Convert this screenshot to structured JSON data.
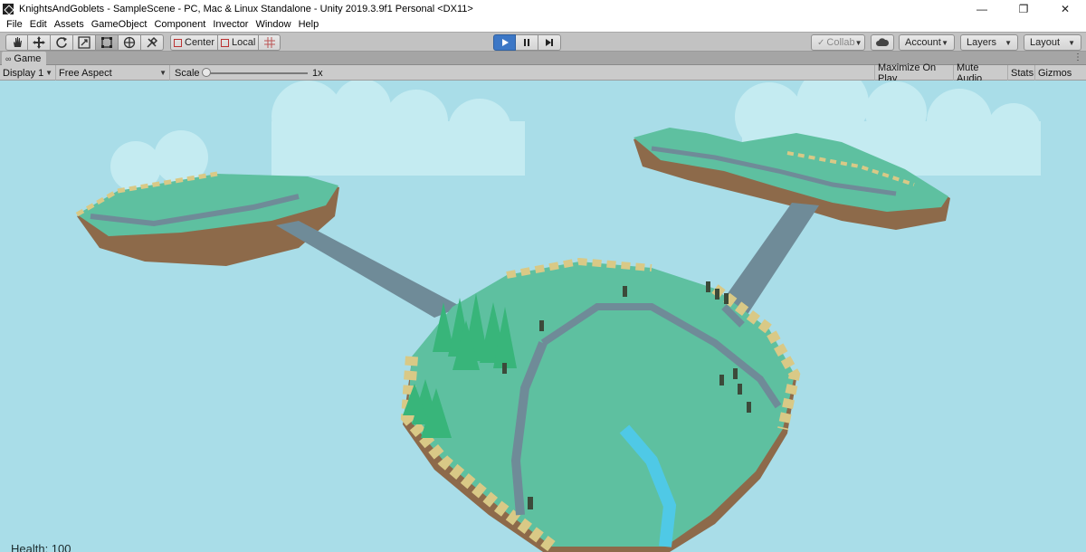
{
  "window": {
    "title": "KnightsAndGoblets - SampleScene - PC, Mac & Linux Standalone - Unity 2019.3.9f1 Personal <DX11>",
    "controls": {
      "minimize": "—",
      "restore": "❐",
      "close": "✕"
    }
  },
  "menu": {
    "items": [
      "File",
      "Edit",
      "Assets",
      "GameObject",
      "Component",
      "Invector",
      "Window",
      "Help"
    ]
  },
  "toolbar": {
    "tools": [
      "hand-icon",
      "move-icon",
      "rotate-icon",
      "scale-icon",
      "rect-icon",
      "transform-icon",
      "custom-tool-icon"
    ],
    "pivot_label": "Center",
    "space_label": "Local",
    "collab_label": "Collab",
    "account_label": "Account",
    "layers_label": "Layers",
    "layout_label": "Layout",
    "play_active": true
  },
  "game_tab": {
    "label": "Game"
  },
  "game_view": {
    "display_label": "Display 1",
    "aspect_label": "Free Aspect",
    "scale_label": "Scale",
    "scale_value": "1x",
    "maximize_label": "Maximize On Play",
    "mute_label": "Mute Audio",
    "stats_label": "Stats",
    "gizmos_label": "Gizmos"
  },
  "hud": {
    "health_text": "Health: 100"
  },
  "colors": {
    "sky": "#a9dde8",
    "grass": "#5ec0a0",
    "sand": "#d9c986",
    "path": "#6f8b98",
    "play_blue": "#3c77c6"
  }
}
